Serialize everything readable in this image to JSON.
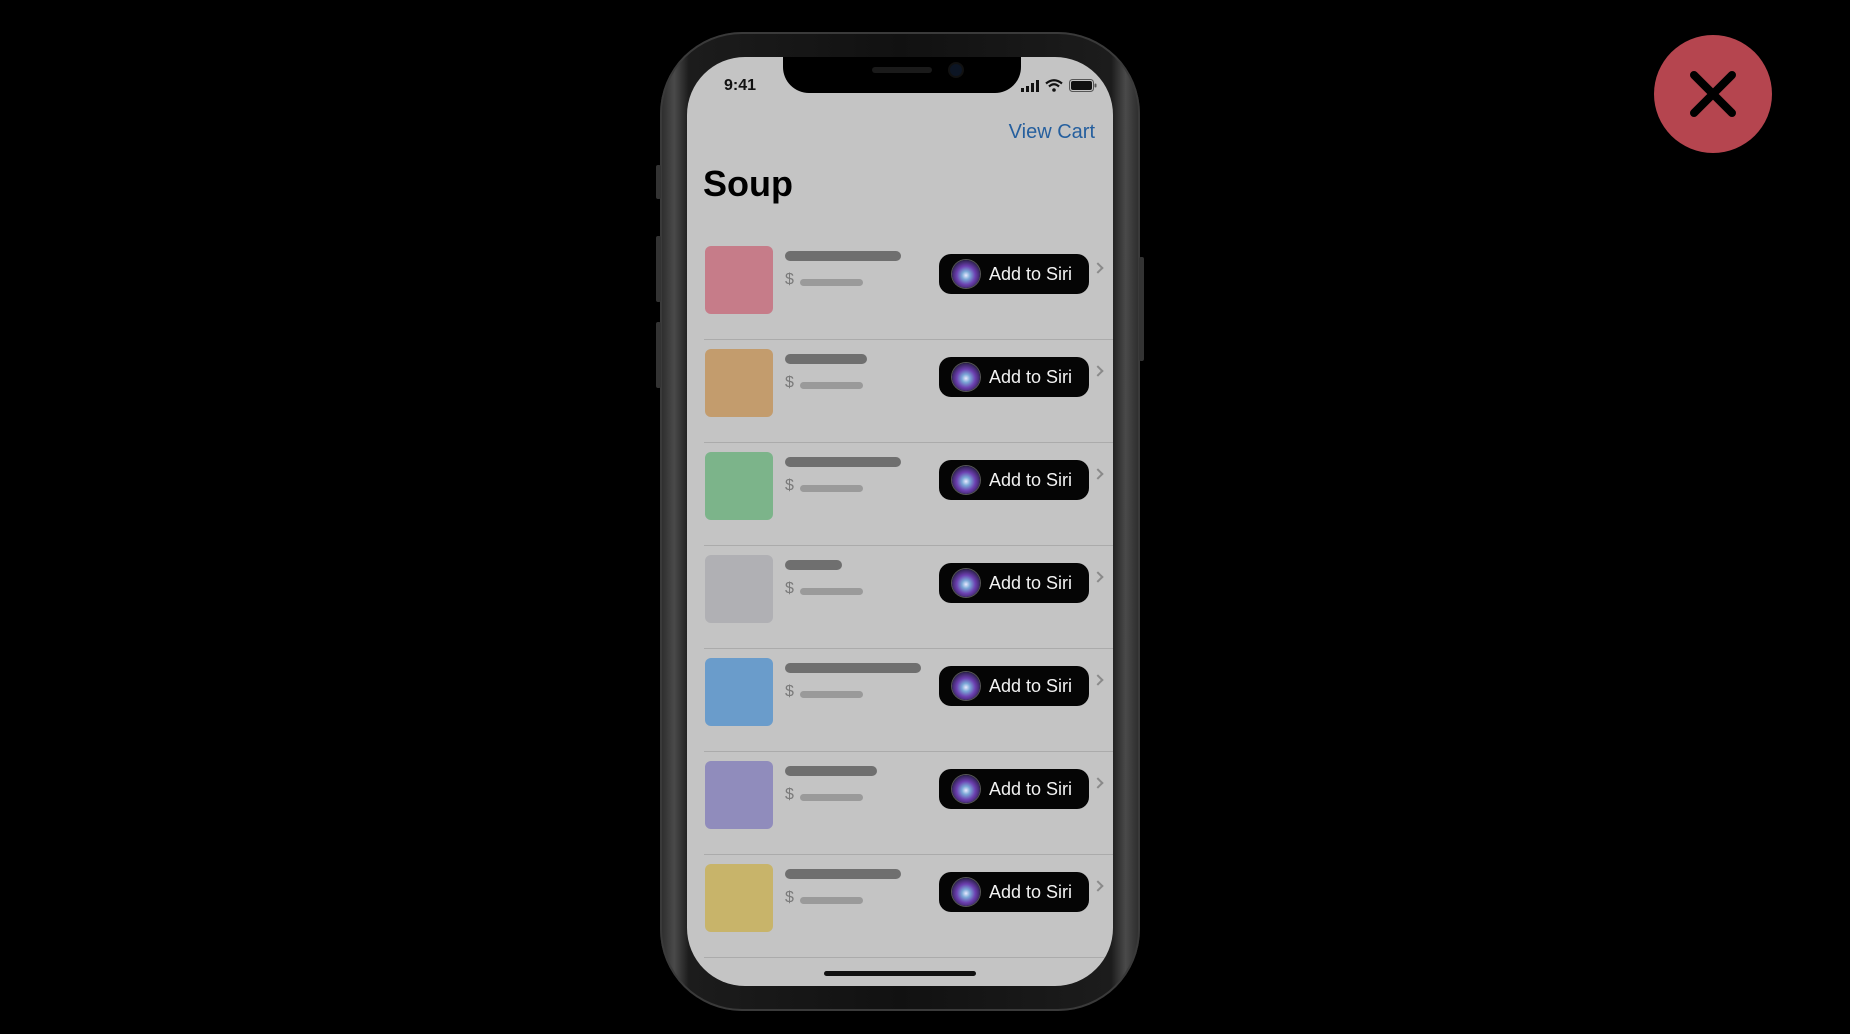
{
  "close": {
    "icon": "close-x-icon",
    "color": "#b5454f"
  },
  "status": {
    "time": "9:41"
  },
  "nav": {
    "view_cart": "View Cart"
  },
  "page": {
    "title": "Soup"
  },
  "items": [
    {
      "thumb_color": "#c67c89",
      "currency": "$",
      "siri_label": "Add to Siri"
    },
    {
      "thumb_color": "#c39c6d",
      "currency": "$",
      "siri_label": "Add to Siri"
    },
    {
      "thumb_color": "#7cb48a",
      "currency": "$",
      "siri_label": "Add to Siri"
    },
    {
      "thumb_color": "#b0b0b4",
      "currency": "$",
      "siri_label": "Add to Siri"
    },
    {
      "thumb_color": "#6a9ccb",
      "currency": "$",
      "siri_label": "Add to Siri"
    },
    {
      "thumb_color": "#908cbc",
      "currency": "$",
      "siri_label": "Add to Siri"
    },
    {
      "thumb_color": "#c8b46a",
      "currency": "$",
      "siri_label": "Add to Siri"
    }
  ]
}
